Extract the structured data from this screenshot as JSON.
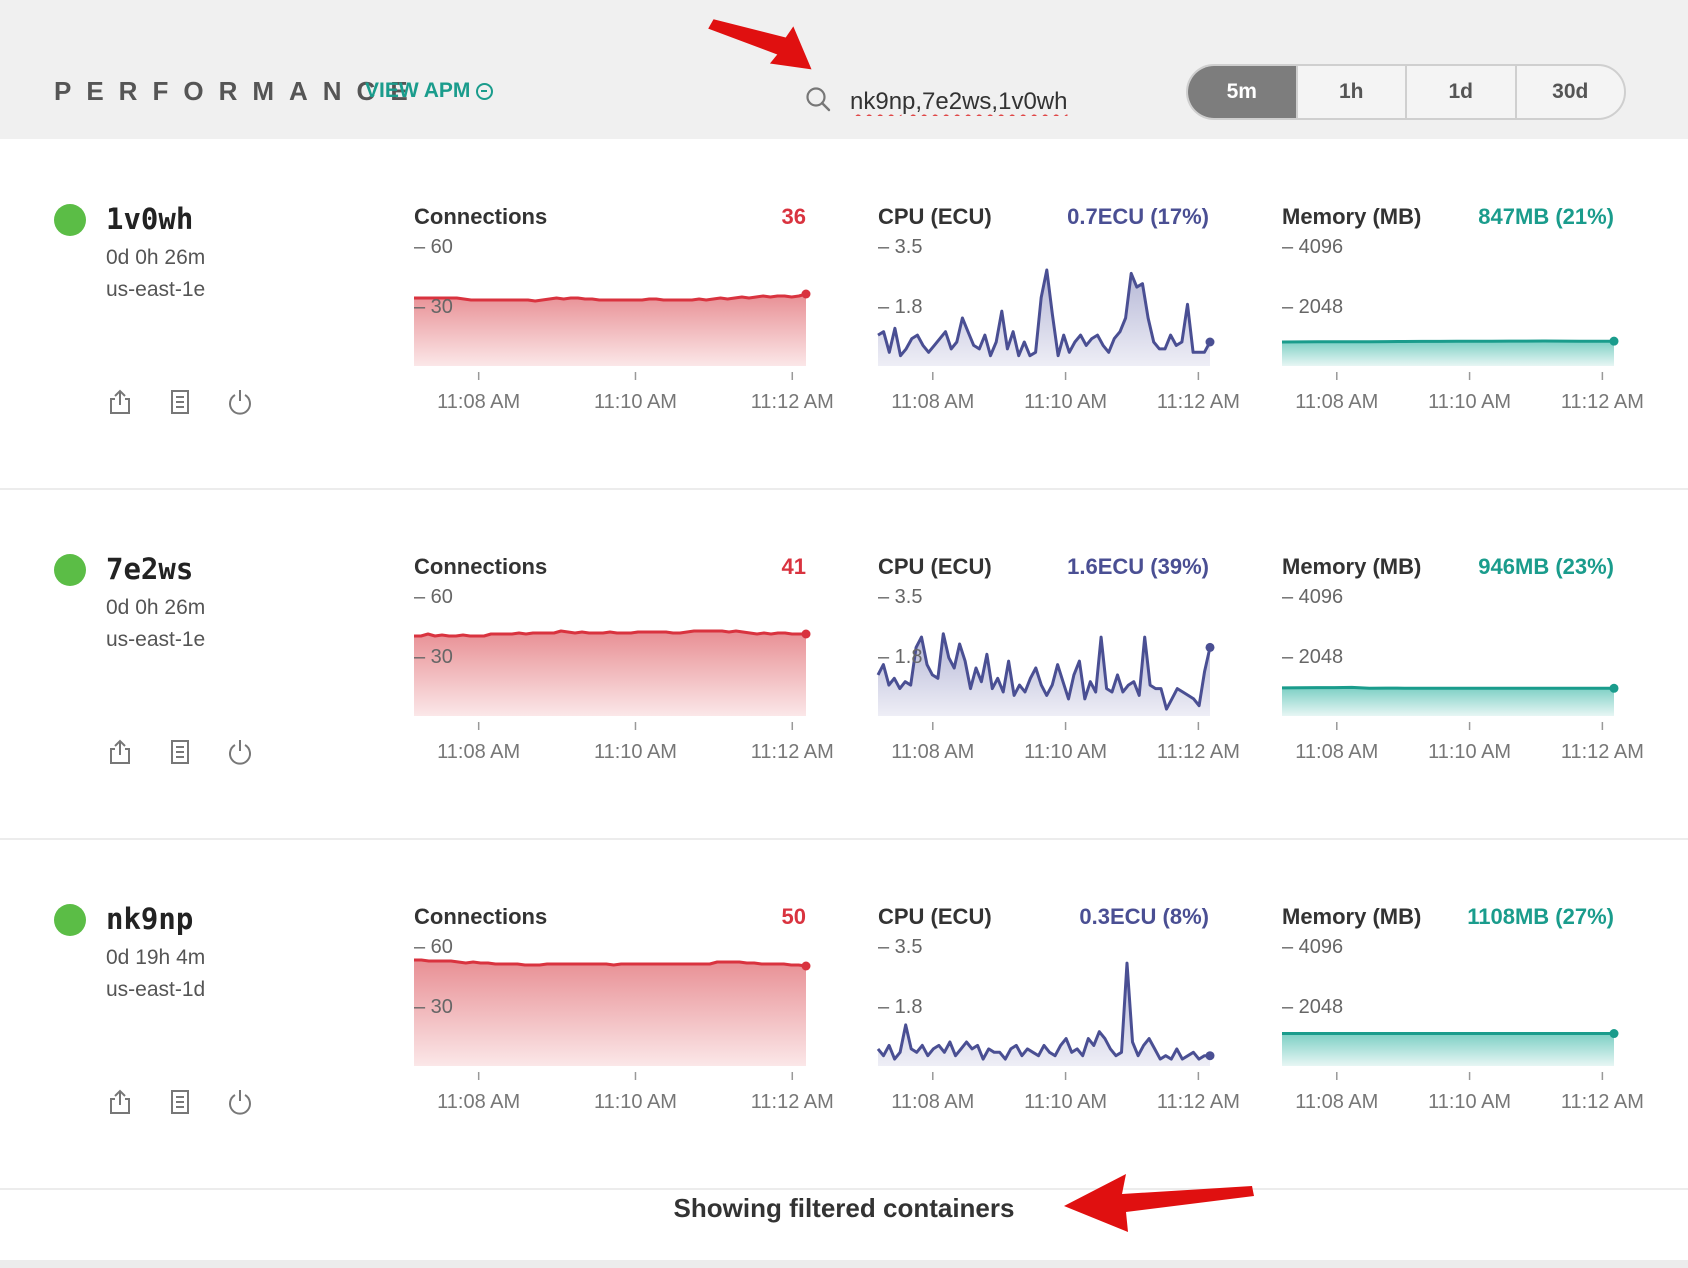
{
  "header": {
    "title": "PERFORMANCE",
    "view_apm": "VIEW APM",
    "search_value": "nk9np,7e2ws,1v0wh",
    "ranges": [
      "5m",
      "1h",
      "1d",
      "30d"
    ],
    "active_range": "5m"
  },
  "containers": [
    {
      "name": "1v0wh",
      "uptime": "0d 0h 26m",
      "region": "us-east-1e",
      "status_color": "#5bbd46",
      "connections": {
        "title": "Connections",
        "value": "36",
        "ticks": [
          "60",
          "30"
        ],
        "x_labels": [
          "11:08 AM",
          "11:10 AM",
          "11:12 AM"
        ],
        "ymax": 60,
        "series": [
          34,
          34,
          34,
          34,
          34,
          34,
          34,
          33.5,
          33,
          33,
          33,
          33,
          33,
          33,
          33,
          33,
          33,
          32.5,
          33,
          33.5,
          34,
          33.5,
          34,
          34,
          33.5,
          33.5,
          33,
          33,
          33,
          33,
          33,
          33,
          33,
          33.5,
          33.5,
          33,
          33,
          33,
          33,
          33,
          33.5,
          33,
          33.5,
          34,
          33.5,
          34,
          34.5,
          34,
          34.5,
          35,
          34.5,
          35,
          35,
          34.5,
          35,
          36
        ]
      },
      "cpu": {
        "title": "CPU (ECU)",
        "value": "0.7ECU (17%)",
        "ticks": [
          "3.5",
          "1.8"
        ],
        "x_labels": [
          "11:08 AM",
          "11:10 AM",
          "11:12 AM"
        ],
        "ymax": 3.5,
        "series": [
          0.9,
          1.0,
          0.4,
          1.1,
          0.3,
          0.5,
          0.8,
          0.9,
          0.6,
          0.4,
          0.6,
          0.8,
          1.0,
          0.5,
          0.7,
          1.4,
          1.0,
          0.6,
          0.5,
          0.9,
          0.3,
          0.7,
          1.6,
          0.5,
          1.0,
          0.3,
          0.7,
          0.3,
          0.4,
          2.0,
          2.8,
          1.5,
          0.3,
          0.9,
          0.4,
          0.7,
          0.9,
          0.6,
          0.8,
          0.9,
          0.6,
          0.4,
          0.8,
          1.0,
          1.4,
          2.7,
          2.3,
          2.4,
          1.4,
          0.7,
          0.5,
          0.5,
          0.9,
          0.6,
          0.7,
          1.8,
          0.4,
          0.4,
          0.4,
          0.7
        ]
      },
      "memory": {
        "title": "Memory (MB)",
        "value": "847MB (21%)",
        "ticks": [
          "4096",
          "2048"
        ],
        "x_labels": [
          "11:08 AM",
          "11:10 AM",
          "11:12 AM"
        ],
        "ymax": 4096,
        "series": [
          820,
          822,
          825,
          825,
          828,
          830,
          832,
          835,
          838,
          840,
          842,
          845,
          848,
          850,
          850,
          852,
          850,
          848,
          847,
          847
        ]
      }
    },
    {
      "name": "7e2ws",
      "uptime": "0d 0h 26m",
      "region": "us-east-1e",
      "status_color": "#5bbd46",
      "connections": {
        "title": "Connections",
        "value": "41",
        "ticks": [
          "60",
          "30"
        ],
        "x_labels": [
          "11:08 AM",
          "11:10 AM",
          "11:12 AM"
        ],
        "ymax": 60,
        "series": [
          40,
          40,
          41,
          40,
          40.5,
          40,
          40,
          40.5,
          40,
          40,
          40,
          41,
          41,
          41,
          41,
          41.5,
          41,
          41.5,
          41.5,
          41.5,
          41.5,
          42.5,
          42,
          41.5,
          42,
          41.5,
          41.5,
          41.5,
          42,
          41.5,
          41.5,
          41.5,
          42,
          42,
          42,
          42,
          42,
          41.5,
          41.5,
          42,
          42.5,
          42.5,
          42.5,
          42.5,
          42.5,
          42,
          42.5,
          42,
          41.5,
          41,
          41.5,
          41,
          41.5,
          41.5,
          41,
          41,
          41
        ]
      },
      "cpu": {
        "title": "CPU (ECU)",
        "value": "1.6ECU (39%)",
        "ticks": [
          "3.5",
          "1.8"
        ],
        "x_labels": [
          "11:08 AM",
          "11:10 AM",
          "11:12 AM"
        ],
        "ymax": 3.5,
        "series": [
          1.2,
          1.5,
          0.9,
          1.1,
          0.8,
          1.0,
          0.9,
          2.0,
          2.3,
          1.5,
          1.2,
          1.1,
          2.4,
          1.7,
          1.4,
          2.1,
          1.6,
          0.8,
          1.4,
          1.0,
          1.8,
          0.8,
          1.1,
          0.7,
          1.6,
          0.6,
          0.9,
          0.7,
          1.1,
          1.4,
          0.9,
          0.6,
          0.9,
          1.5,
          1.0,
          0.5,
          1.2,
          1.6,
          0.5,
          1.0,
          0.7,
          2.3,
          0.8,
          0.7,
          1.2,
          0.7,
          0.9,
          1.0,
          0.6,
          2.3,
          0.9,
          0.8,
          0.8,
          0.2,
          0.5,
          0.8,
          0.7,
          0.6,
          0.5,
          0.3,
          1.3,
          2.0
        ]
      },
      "memory": {
        "title": "Memory (MB)",
        "value": "946MB (23%)",
        "ticks": [
          "4096",
          "2048"
        ],
        "x_labels": [
          "11:08 AM",
          "11:10 AM",
          "11:12 AM"
        ],
        "ymax": 4096,
        "series": [
          960,
          965,
          970,
          970,
          975,
          950,
          952,
          950,
          948,
          950,
          950,
          950,
          948,
          948,
          946,
          945,
          945,
          946,
          946,
          946
        ]
      }
    },
    {
      "name": "nk9np",
      "uptime": "0d 19h 4m",
      "region": "us-east-1d",
      "status_color": "#5bbd46",
      "connections": {
        "title": "Connections",
        "value": "50",
        "ticks": [
          "60",
          "30"
        ],
        "x_labels": [
          "11:08 AM",
          "11:10 AM",
          "11:12 AM"
        ],
        "ymax": 60,
        "series": [
          53,
          53,
          52.5,
          52.5,
          52.5,
          52.5,
          52,
          51.5,
          52,
          51.5,
          51.5,
          51,
          51,
          51,
          51,
          50.5,
          50.5,
          50.5,
          51,
          51,
          51,
          51,
          51,
          51,
          51,
          51,
          51,
          50.5,
          51,
          51,
          51,
          51,
          51,
          51,
          51,
          51,
          51,
          51,
          51,
          51,
          51,
          52,
          52,
          52,
          52,
          51.5,
          51.5,
          51,
          51,
          51,
          51,
          50.5,
          50.5,
          50
        ]
      },
      "cpu": {
        "title": "CPU (ECU)",
        "value": "0.3ECU (8%)",
        "ticks": [
          "3.5",
          "1.8"
        ],
        "x_labels": [
          "11:08 AM",
          "11:10 AM",
          "11:12 AM"
        ],
        "ymax": 3.5,
        "series": [
          0.5,
          0.3,
          0.6,
          0.2,
          0.4,
          1.2,
          0.5,
          0.4,
          0.6,
          0.3,
          0.5,
          0.6,
          0.4,
          0.7,
          0.3,
          0.5,
          0.7,
          0.5,
          0.6,
          0.2,
          0.5,
          0.4,
          0.4,
          0.2,
          0.5,
          0.6,
          0.3,
          0.5,
          0.4,
          0.3,
          0.6,
          0.4,
          0.3,
          0.6,
          0.8,
          0.4,
          0.5,
          0.3,
          0.8,
          0.6,
          1.0,
          0.8,
          0.5,
          0.3,
          0.4,
          3.0,
          0.7,
          0.3,
          0.6,
          0.8,
          0.5,
          0.2,
          0.3,
          0.2,
          0.5,
          0.2,
          0.3,
          0.4,
          0.2,
          0.3,
          0.3
        ]
      },
      "memory": {
        "title": "Memory (MB)",
        "value": "1108MB (27%)",
        "ticks": [
          "4096",
          "2048"
        ],
        "x_labels": [
          "11:08 AM",
          "11:10 AM",
          "11:12 AM"
        ],
        "ymax": 4096,
        "series": [
          1108,
          1108,
          1108,
          1108,
          1108,
          1108,
          1108,
          1108,
          1108,
          1108,
          1108,
          1108,
          1108,
          1108,
          1108,
          1108,
          1108,
          1108,
          1108,
          1108
        ]
      }
    }
  ],
  "footer": {
    "text": "Showing filtered containers"
  },
  "colors": {
    "connections": "#d9333f",
    "cpu": "#4a4f93",
    "memory": "#1a9c8c",
    "annotation_arrow": "#e01010"
  },
  "icons": {
    "search": "search-icon",
    "actions": [
      "share-icon",
      "logs-icon",
      "power-icon"
    ],
    "annotation": "red-arrow-icon"
  }
}
